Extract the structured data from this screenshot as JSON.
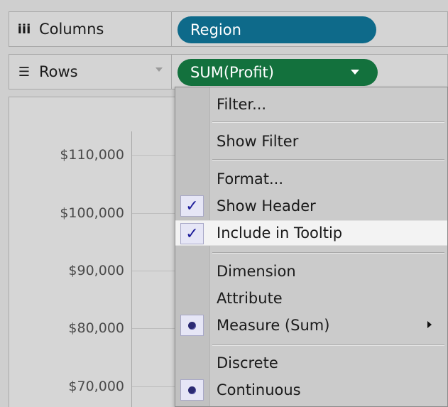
{
  "shelves": {
    "columns": {
      "icon": "columns-icon",
      "label": "Columns",
      "pill": "Region"
    },
    "rows": {
      "icon": "rows-icon",
      "label": "Rows",
      "pill": "SUM(Profit)"
    }
  },
  "colors": {
    "dimension_pill": "#0e6a8a",
    "measure_pill": "#13713d",
    "highlight": "#f3f3f3"
  },
  "axis": {
    "ticks": [
      "$110,000",
      "$100,000",
      "$90,000",
      "$80,000",
      "$70,000"
    ]
  },
  "menu": {
    "items": [
      {
        "label": "Filter...",
        "state": "none"
      },
      {
        "label": "Show Filter",
        "state": "none"
      },
      {
        "label": "Format...",
        "state": "none"
      },
      {
        "label": "Show Header",
        "state": "checked"
      },
      {
        "label": "Include in Tooltip",
        "state": "checked",
        "highlighted": true
      },
      {
        "label": "Dimension",
        "state": "none"
      },
      {
        "label": "Attribute",
        "state": "none"
      },
      {
        "label": "Measure (Sum)",
        "state": "selected",
        "submenu": true
      },
      {
        "label": "Discrete",
        "state": "none"
      },
      {
        "label": "Continuous",
        "state": "selected"
      }
    ],
    "check_glyph": "✓"
  }
}
